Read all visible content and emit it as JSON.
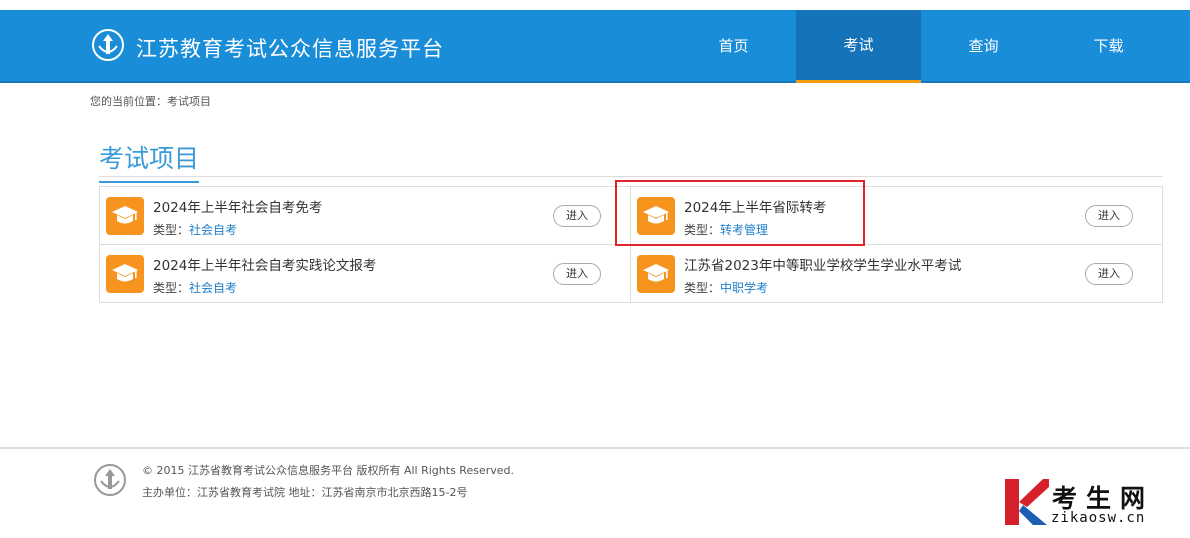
{
  "header": {
    "site_title": "江苏教育考试公众信息服务平台",
    "nav": [
      {
        "label": "首页",
        "active": false
      },
      {
        "label": "考试",
        "active": true
      },
      {
        "label": "查询",
        "active": false
      },
      {
        "label": "下载",
        "active": false
      }
    ]
  },
  "breadcrumb": "您的当前位置：考试项目",
  "section_title": "考试项目",
  "exams": [
    {
      "name": "2024年上半年社会自考免考",
      "type_label": "类型：",
      "type_value": "社会自考",
      "button": "进入"
    },
    {
      "name": "2024年上半年省际转考",
      "type_label": "类型：",
      "type_value": "转考管理",
      "button": "进入"
    },
    {
      "name": "2024年上半年社会自考实践论文报考",
      "type_label": "类型：",
      "type_value": "社会自考",
      "button": "进入"
    },
    {
      "name": "江苏省2023年中等职业学校学生学业水平考试",
      "type_label": "类型：",
      "type_value": "中职学考",
      "button": "进入"
    }
  ],
  "footer": {
    "copyright": "© 2015 江苏省教育考试公众信息服务平台 版权所有 All Rights Reserved.",
    "address": "主办单位：江苏省教育考试院 地址：江苏省南京市北京西路15-2号"
  },
  "watermark": {
    "cn": "考生网",
    "en": "zikaosw.cn"
  },
  "colors": {
    "header_bg": "#1a8dd8",
    "nav_active_bg": "#1573b9",
    "nav_active_border": "#f39c12",
    "accent": "#3a9ad9",
    "icon_bg": "#f7941d",
    "highlight": "#e0262c"
  }
}
